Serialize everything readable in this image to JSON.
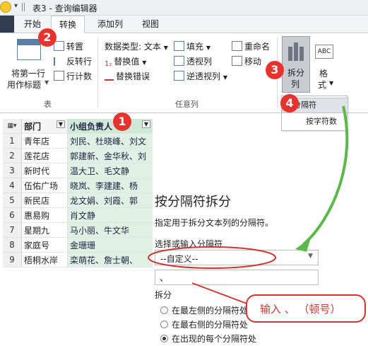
{
  "window": {
    "title": "表3 - 查询编辑器"
  },
  "tabs": [
    {
      "label": "开始"
    },
    {
      "label": "转换"
    },
    {
      "label": "添加列"
    },
    {
      "label": "视图"
    }
  ],
  "ribbon": {
    "table_group": {
      "first_row_header_line1": "将第一行",
      "first_row_header_line2": "用作标题",
      "transpose": "转置",
      "reverse_rows": "反转行",
      "count_rows": "行计数",
      "label": "表"
    },
    "any_column_group": {
      "data_type": "数据类型: 文本",
      "replace_values": "替换值",
      "replace_errors": "替换错误",
      "fill": "填充",
      "pivot_column": "透视列",
      "unpivot_columns": "逆透视列",
      "rename": "重命名",
      "move": "移动",
      "label": "任意列"
    },
    "split_column": {
      "line1": "拆分",
      "line2": "列"
    },
    "format": {
      "line1": "格",
      "line2": "式"
    },
    "split_menu": {
      "by_delimiter": "按分隔符",
      "by_chars": "按字符数"
    }
  },
  "badges": [
    "1",
    "2",
    "3",
    "4"
  ],
  "grid": {
    "col_dept": "部门",
    "col_members": "小组负责人",
    "rows": [
      {
        "n": "1",
        "dept": "青年店",
        "members": "刘民、杜晓峰、刘文"
      },
      {
        "n": "2",
        "dept": "莲花店",
        "members": "郭建新、金华秋、刘"
      },
      {
        "n": "3",
        "dept": "新时代",
        "members": "温大卫、毛文静"
      },
      {
        "n": "4",
        "dept": "伍佑广场",
        "members": "晓岚、李建建、杨"
      },
      {
        "n": "5",
        "dept": "新民店",
        "members": "龙文娟、刘霞、郭"
      },
      {
        "n": "6",
        "dept": "惠易购",
        "members": "肖文静"
      },
      {
        "n": "7",
        "dept": "星期九",
        "members": "马小丽、牛文华"
      },
      {
        "n": "8",
        "dept": "家庭号",
        "members": "金珊珊"
      },
      {
        "n": "9",
        "dept": "梧桐水岸",
        "members": "栾萌花、詹士朝、"
      }
    ]
  },
  "dialog": {
    "title": "按分隔符拆分",
    "description": "指定用于拆分文本列的分隔符。",
    "select_label": "选择或输入分隔符",
    "select_value": "--自定义--",
    "custom_input_value": "、",
    "split_label": "拆分",
    "options": [
      {
        "label": "在最左侧的分隔符处",
        "checked": false
      },
      {
        "label": "在最右侧的分隔符处",
        "checked": false
      },
      {
        "label": "在出现的每个分隔符处",
        "checked": true
      }
    ]
  },
  "callout": {
    "text": "输入 、 （顿号）"
  },
  "colors": {
    "badge": "#e8322d",
    "arrow": "#5cb84a",
    "column_highlight": "#dff1e5",
    "callout_border": "#d0352f"
  }
}
